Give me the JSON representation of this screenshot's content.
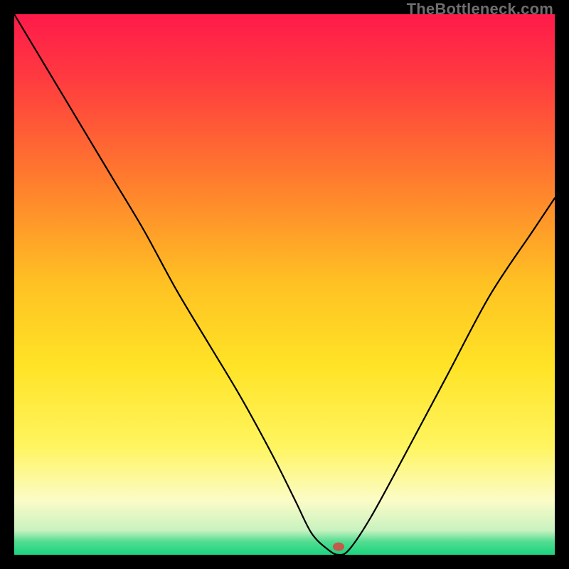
{
  "watermark": "TheBottleneck.com",
  "chart_data": {
    "type": "line",
    "title": "",
    "xlabel": "",
    "ylabel": "",
    "xlim": [
      0,
      100
    ],
    "ylim": [
      0,
      100
    ],
    "grid": false,
    "legend": false,
    "gradient_stops": [
      {
        "offset": 0,
        "color": "#ff1a4b"
      },
      {
        "offset": 0.12,
        "color": "#ff3b3f"
      },
      {
        "offset": 0.3,
        "color": "#ff7a2e"
      },
      {
        "offset": 0.5,
        "color": "#ffc223"
      },
      {
        "offset": 0.65,
        "color": "#ffe326"
      },
      {
        "offset": 0.8,
        "color": "#fff560"
      },
      {
        "offset": 0.9,
        "color": "#fbfcc7"
      },
      {
        "offset": 0.955,
        "color": "#c8f2c0"
      },
      {
        "offset": 0.975,
        "color": "#55dd92"
      },
      {
        "offset": 1.0,
        "color": "#1ad37f"
      }
    ],
    "series": [
      {
        "name": "bottleneck-curve",
        "color": "#000000",
        "x": [
          0,
          6,
          12,
          18,
          24,
          30,
          36,
          42,
          48,
          52,
          55,
          58,
          60,
          62,
          66,
          72,
          80,
          88,
          96,
          100
        ],
        "y": [
          100,
          90,
          80,
          70,
          60,
          49,
          39,
          29,
          18,
          10,
          4,
          1,
          0,
          1,
          7,
          18,
          33,
          48,
          60,
          66
        ]
      }
    ],
    "marker": {
      "name": "optimal-point",
      "x": 60,
      "y": 1.5,
      "rx": 8,
      "ry": 6,
      "fill": "#c45a4a"
    }
  }
}
